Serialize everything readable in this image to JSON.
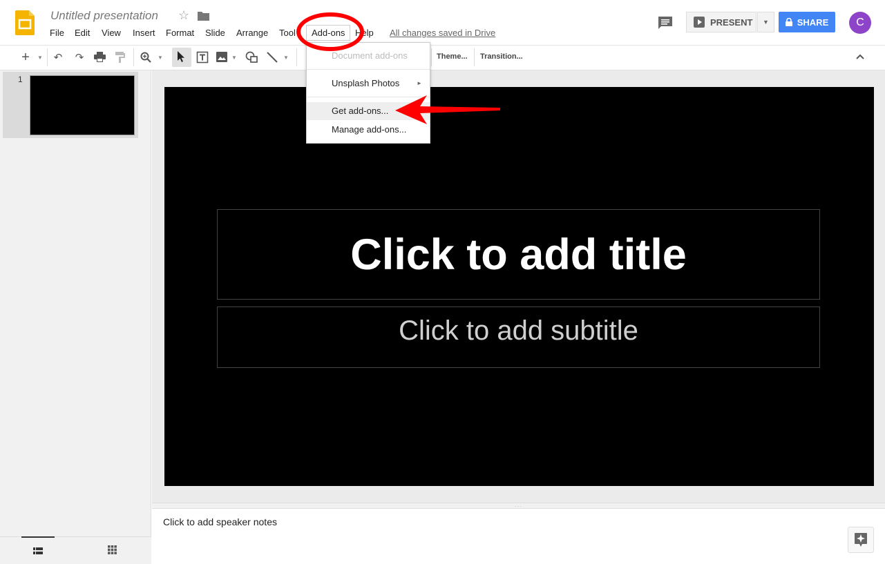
{
  "header": {
    "title": "Untitled presentation",
    "save_status": "All changes saved in Drive",
    "menus": [
      "File",
      "Edit",
      "View",
      "Insert",
      "Format",
      "Slide",
      "Arrange",
      "Tool",
      "Add-ons",
      "Help"
    ],
    "present_label": "PRESENT",
    "share_label": "SHARE",
    "avatar_letter": "C"
  },
  "toolbar": {
    "theme_label": "Theme...",
    "transition_label": "Transition..."
  },
  "addons_menu": {
    "items": [
      "Document add-ons",
      "Unsplash Photos",
      "Get add-ons...",
      "Manage add-ons..."
    ],
    "disabled_item": "Document add-ons",
    "submenu_arrow": "►"
  },
  "filmstrip": {
    "slide_number": "1"
  },
  "slide": {
    "title_placeholder": "Click to add title",
    "subtitle_placeholder": "Click to add subtitle"
  },
  "notes": {
    "placeholder": "Click to add speaker notes"
  },
  "colors": {
    "share_blue": "#4285f4",
    "annotation_red": "#ff0000",
    "avatar_purple": "#8e44c9",
    "logo_yellow": "#f4b400"
  }
}
